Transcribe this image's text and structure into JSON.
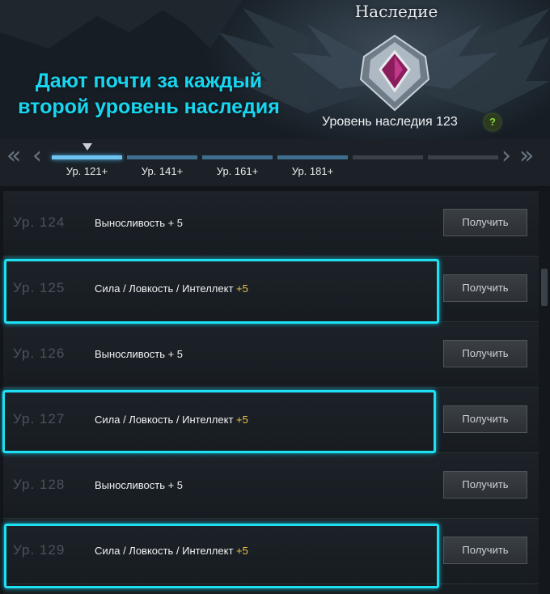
{
  "header": {
    "title": "Наследие",
    "annotation_line1": "Дают почти за каждый",
    "annotation_line2": "второй уровень наследия",
    "level_text": "Уровень наследия 123",
    "help": "?"
  },
  "tabs": {
    "labels": [
      "Ур. 121+",
      "Ур. 141+",
      "Ур. 161+",
      "Ур. 181+"
    ]
  },
  "rows": [
    {
      "level": "Ур. 124",
      "desc": "Выносливость + 5",
      "bonus": "",
      "button": "Получить"
    },
    {
      "level": "Ур. 125",
      "desc": "Сила / Ловкость / Интеллект ",
      "bonus": "+5",
      "button": "Получить"
    },
    {
      "level": "Ур. 126",
      "desc": "Выносливость + 5",
      "bonus": "",
      "button": "Получить"
    },
    {
      "level": "Ур. 127",
      "desc": "Сила / Ловкость / Интеллект ",
      "bonus": "+5",
      "button": "Получить"
    },
    {
      "level": "Ур. 128",
      "desc": "Выносливость + 5",
      "bonus": "",
      "button": "Получить"
    },
    {
      "level": "Ур. 129",
      "desc": "Сила / Ловкость / Интеллект ",
      "bonus": "+5",
      "button": "Получить"
    }
  ],
  "colors": {
    "annotation": "#18d6f0",
    "highlight": "#1ee0f2",
    "bonus": "#e9c44a"
  }
}
